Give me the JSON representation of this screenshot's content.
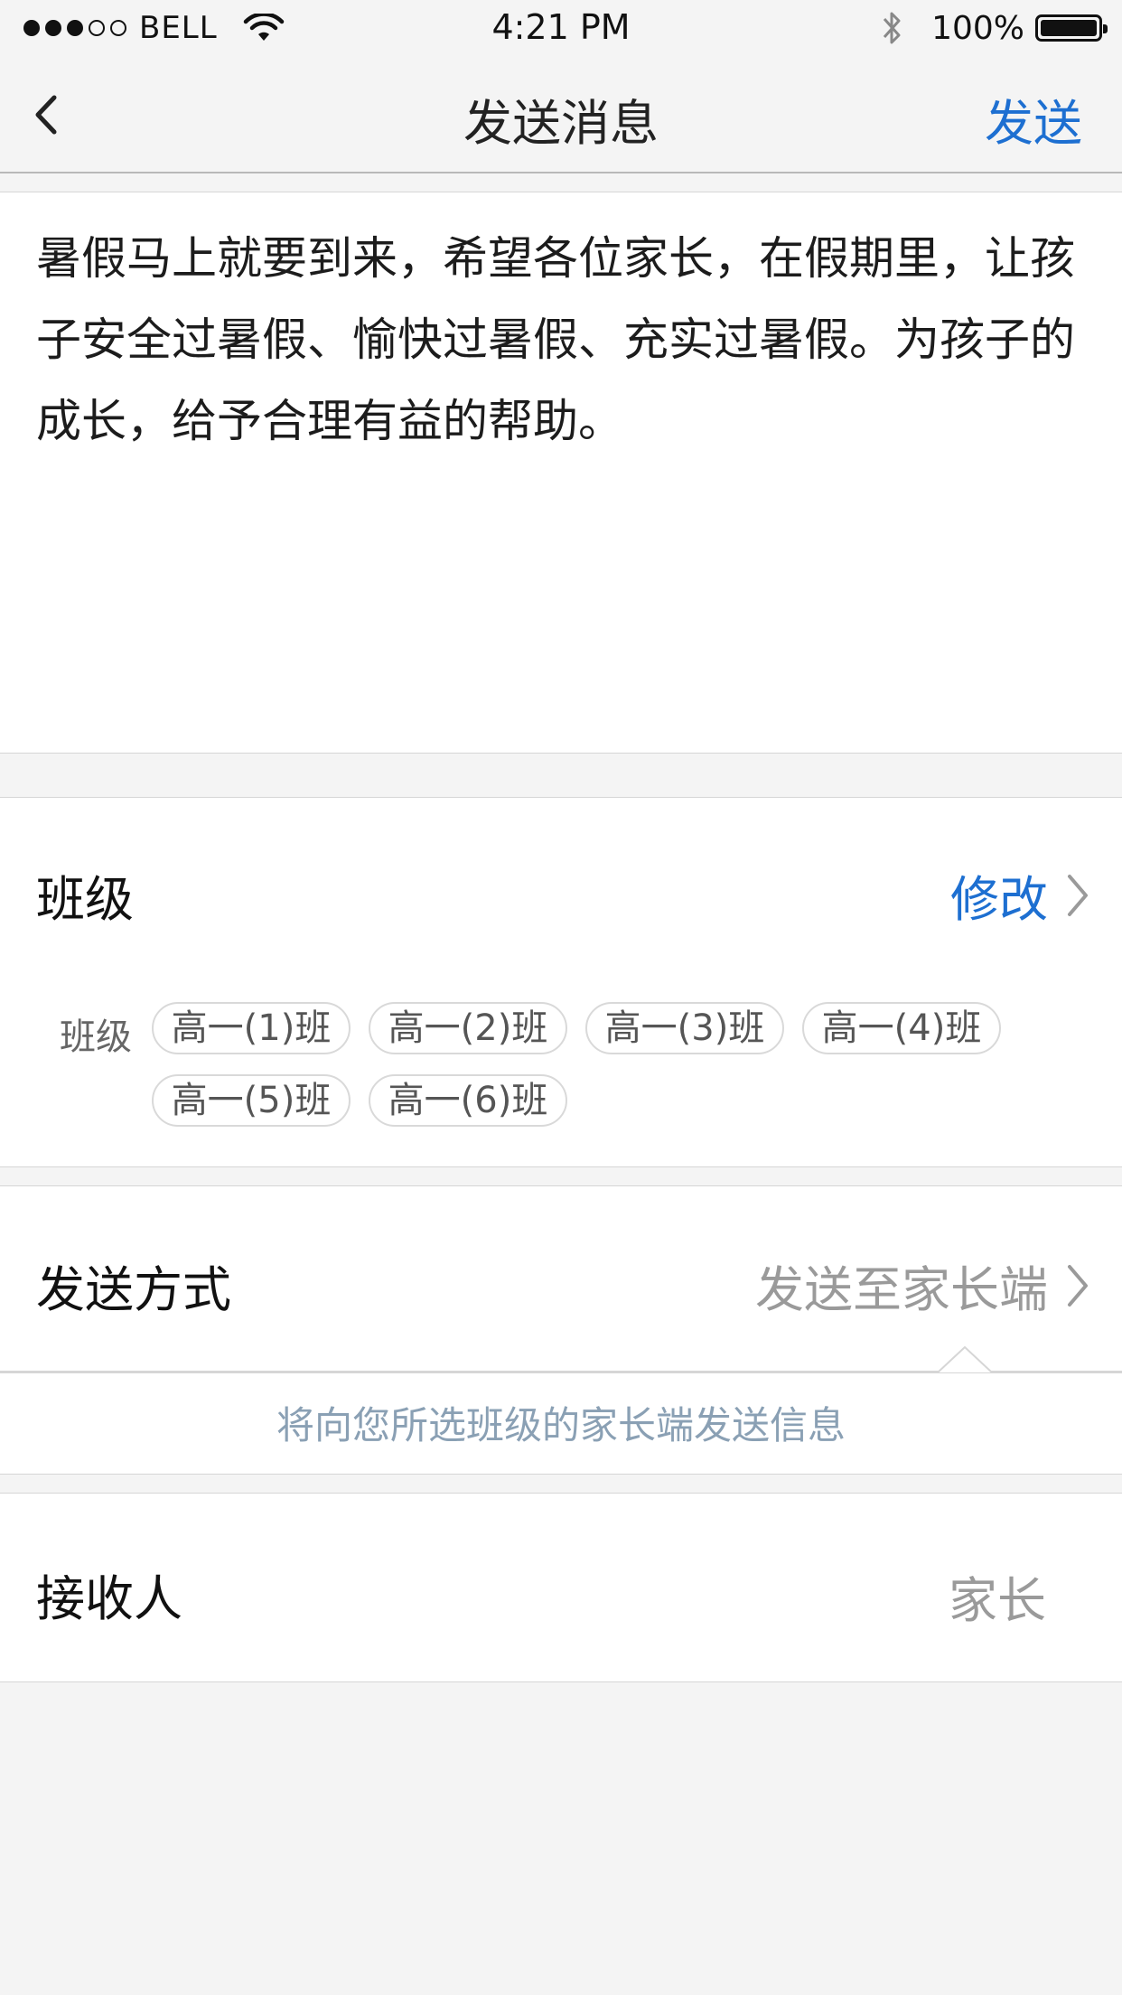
{
  "status_bar": {
    "carrier": "BELL",
    "time": "4:21 PM",
    "battery_percent": "100%",
    "signal_bars_filled": 3,
    "signal_bars_total": 5,
    "icons": [
      "wifi-icon",
      "bluetooth-icon",
      "battery-icon"
    ]
  },
  "nav": {
    "title": "发送消息",
    "send_label": "发送",
    "back_icon": "chevron-left-icon"
  },
  "message": {
    "text": "暑假马上就要到来，希望各位家长，在假期里，让孩子安全过暑假、愉快过暑假、充实过暑假。为孩子的成长，给予合理有益的帮助。"
  },
  "class_section": {
    "label": "班级",
    "modify_label": "修改",
    "chips_label": "班级",
    "chips": [
      "高一(1)班",
      "高一(2)班",
      "高一(3)班",
      "高一(4)班",
      "高一(5)班",
      "高一(6)班"
    ]
  },
  "method_section": {
    "label": "发送方式",
    "value": "发送至家长端",
    "hint": "将向您所选班级的家长端发送信息"
  },
  "receiver_section": {
    "label": "接收人",
    "value": "家长"
  },
  "colors": {
    "accent": "#1d6fd1",
    "background": "#f4f4f4",
    "muted_text": "#9a9a9a",
    "hint_text": "#8aa0b4"
  }
}
